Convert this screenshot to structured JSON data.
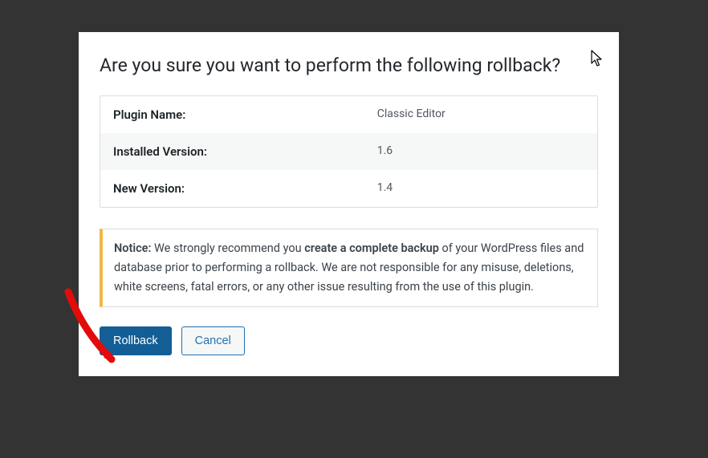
{
  "heading": "Are you sure you want to perform the following rollback?",
  "table": {
    "rows": [
      {
        "label": "Plugin Name:",
        "value": "Classic Editor"
      },
      {
        "label": "Installed Version:",
        "value": "1.6"
      },
      {
        "label": "New Version:",
        "value": "1.4"
      }
    ]
  },
  "notice": {
    "prefix": "Notice:",
    "part1": " We strongly recommend you ",
    "bold": "create a complete backup",
    "part2": " of your WordPress files and database prior to performing a rollback. We are not responsible for any misuse, deletions, white screens, fatal errors, or any other issue resulting from the use of this plugin."
  },
  "buttons": {
    "rollback": "Rollback",
    "cancel": "Cancel"
  }
}
